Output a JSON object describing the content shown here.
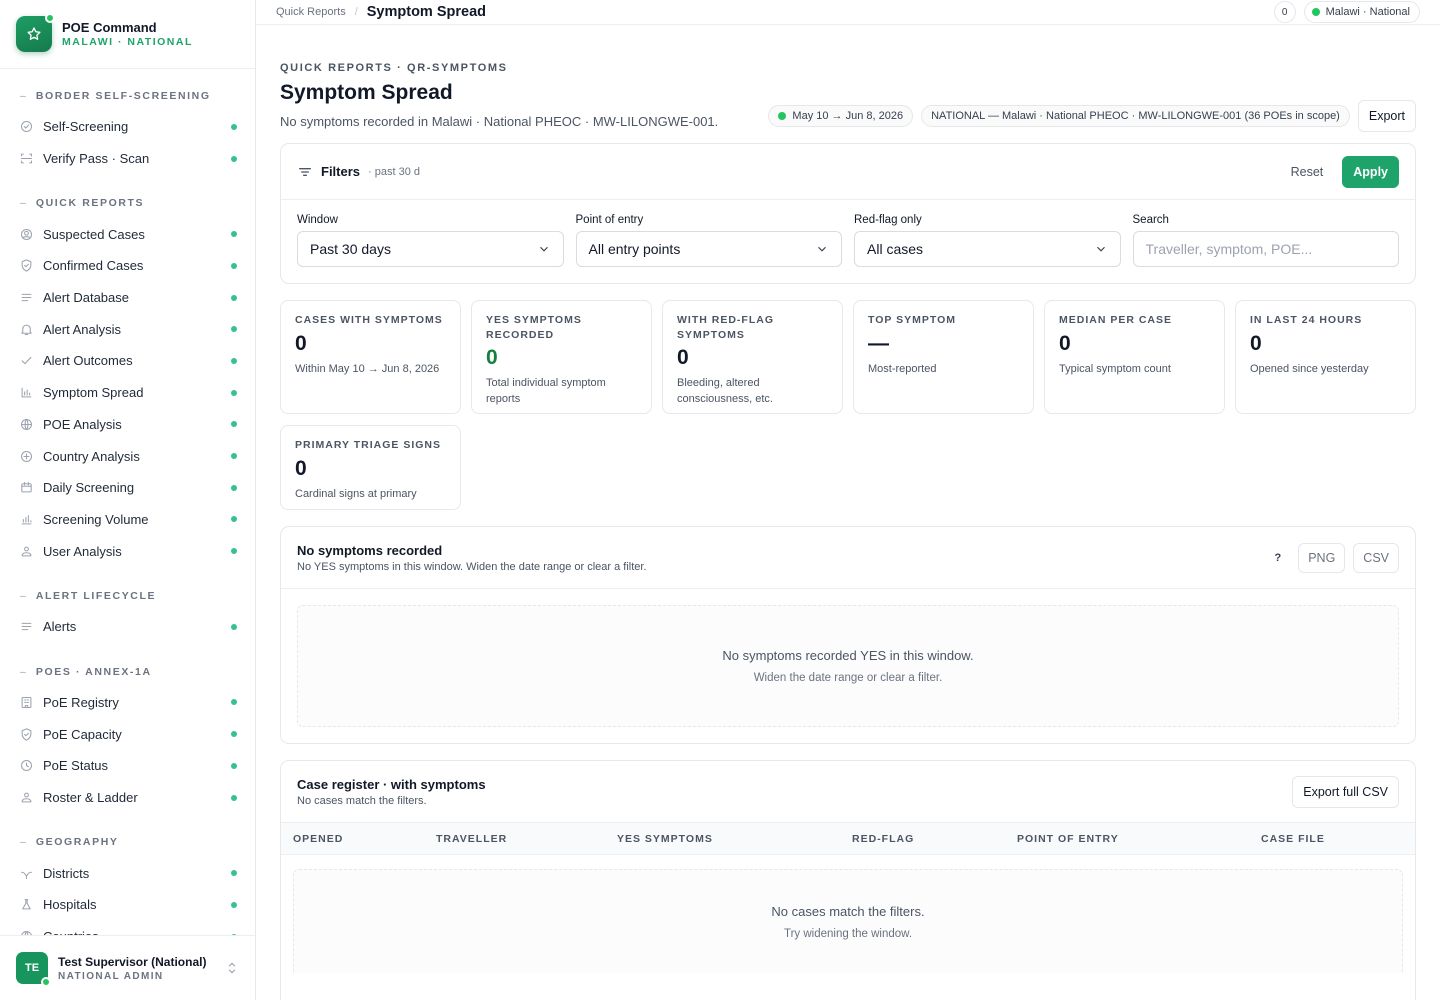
{
  "brand": {
    "title": "POE Command",
    "subtitle": "MALAWI · NATIONAL"
  },
  "sidebar": {
    "sections": [
      {
        "heading": "BORDER SELF-SCREENING",
        "items": [
          {
            "label": "Self-Screening",
            "icon": "check-circle-icon"
          },
          {
            "label": "Verify Pass · Scan",
            "icon": "scan-icon"
          }
        ]
      },
      {
        "heading": "QUICK REPORTS",
        "items": [
          {
            "label": "Suspected Cases",
            "icon": "person-circle-icon"
          },
          {
            "label": "Confirmed Cases",
            "icon": "shield-check-icon"
          },
          {
            "label": "Alert Database",
            "icon": "list-icon"
          },
          {
            "label": "Alert Analysis",
            "icon": "bell-icon"
          },
          {
            "label": "Alert Outcomes",
            "icon": "check-icon"
          },
          {
            "label": "Symptom Spread",
            "icon": "bar-chart-icon"
          },
          {
            "label": "POE Analysis",
            "icon": "globe-icon"
          },
          {
            "label": "Country Analysis",
            "icon": "compass-icon"
          },
          {
            "label": "Daily Screening",
            "icon": "calendar-icon"
          },
          {
            "label": "Screening Volume",
            "icon": "column-chart-icon"
          },
          {
            "label": "User Analysis",
            "icon": "users-icon"
          }
        ]
      },
      {
        "heading": "ALERT LIFECYCLE",
        "items": [
          {
            "label": "Alerts",
            "icon": "list-icon"
          }
        ]
      },
      {
        "heading": "POES · ANNEX-1A",
        "items": [
          {
            "label": "PoE Registry",
            "icon": "building-icon"
          },
          {
            "label": "PoE Capacity",
            "icon": "shield-check-icon"
          },
          {
            "label": "PoE Status",
            "icon": "clock-icon"
          },
          {
            "label": "Roster & Ladder",
            "icon": "users-icon"
          }
        ]
      },
      {
        "heading": "GEOGRAPHY",
        "items": [
          {
            "label": "Districts",
            "icon": "branch-icon"
          },
          {
            "label": "Hospitals",
            "icon": "flask-icon"
          },
          {
            "label": "Countries",
            "icon": "globe-icon"
          }
        ]
      }
    ]
  },
  "user": {
    "initials": "TE",
    "name": "Test Supervisor (National)",
    "role": "NATIONAL ADMIN"
  },
  "topbar": {
    "crumb_parent": "Quick Reports",
    "crumb_current": "Symptom Spread",
    "count": "0",
    "scope": "Malawi · National"
  },
  "header": {
    "eyebrow": "QUICK REPORTS · QR-SYMPTOMS",
    "title": "Symptom Spread",
    "subtitle": "No symptoms recorded in Malawi · National PHEOC · MW-LILONGWE-001.",
    "date_range": "May 10 → Jun 8, 2026",
    "scope_tag": "NATIONAL — Malawi · National PHEOC · MW-LILONGWE-001 (36 POEs in scope)",
    "export_label": "Export"
  },
  "filters": {
    "title": "Filters",
    "meta": "· past 30 d",
    "reset_label": "Reset",
    "apply_label": "Apply",
    "window": {
      "label": "Window",
      "value": "Past 30 days"
    },
    "poe": {
      "label": "Point of entry",
      "value": "All entry points"
    },
    "redflag": {
      "label": "Red-flag only",
      "value": "All cases"
    },
    "search": {
      "label": "Search",
      "placeholder": "Traveller, symptom, POE..."
    }
  },
  "kpis": [
    {
      "label": "CASES WITH SYMPTOMS",
      "value": "0",
      "desc": "Within May 10 → Jun 8, 2026"
    },
    {
      "label": "YES SYMPTOMS RECORDED",
      "value": "0",
      "desc": "Total individual symptom reports",
      "accent": "#15803d"
    },
    {
      "label": "WITH RED-FLAG SYMPTOMS",
      "value": "0",
      "desc": "Bleeding, altered consciousness, etc."
    },
    {
      "label": "TOP SYMPTOM",
      "value": "—",
      "desc": "Most-reported"
    },
    {
      "label": "MEDIAN PER CASE",
      "value": "0",
      "desc": "Typical symptom count"
    },
    {
      "label": "IN LAST 24 HOURS",
      "value": "0",
      "desc": "Opened since yesterday"
    },
    {
      "label": "PRIMARY TRIAGE SIGNS",
      "value": "0",
      "desc": "Cardinal signs at primary"
    }
  ],
  "symptoms_panel": {
    "title": "No symptoms recorded",
    "subtitle": "No YES symptoms in this window. Widen the date range or clear a filter.",
    "help_label": "?",
    "png_label": "PNG",
    "csv_label": "CSV",
    "empty_title": "No symptoms recorded YES in this window.",
    "empty_sub": "Widen the date range or clear a filter."
  },
  "register": {
    "title": "Case register · with symptoms",
    "subtitle": "No cases match the filters.",
    "export_label": "Export full CSV",
    "columns": [
      "OPENED",
      "TRAVELLER",
      "YES SYMPTOMS",
      "RED-FLAG",
      "POINT OF ENTRY",
      "CASE FILE"
    ],
    "empty_title": "No cases match the filters.",
    "empty_sub": "Try widening the window."
  },
  "colors": {
    "brand": "#1ea36a",
    "status_dot": "#34c38f",
    "online": "#22c55e"
  }
}
